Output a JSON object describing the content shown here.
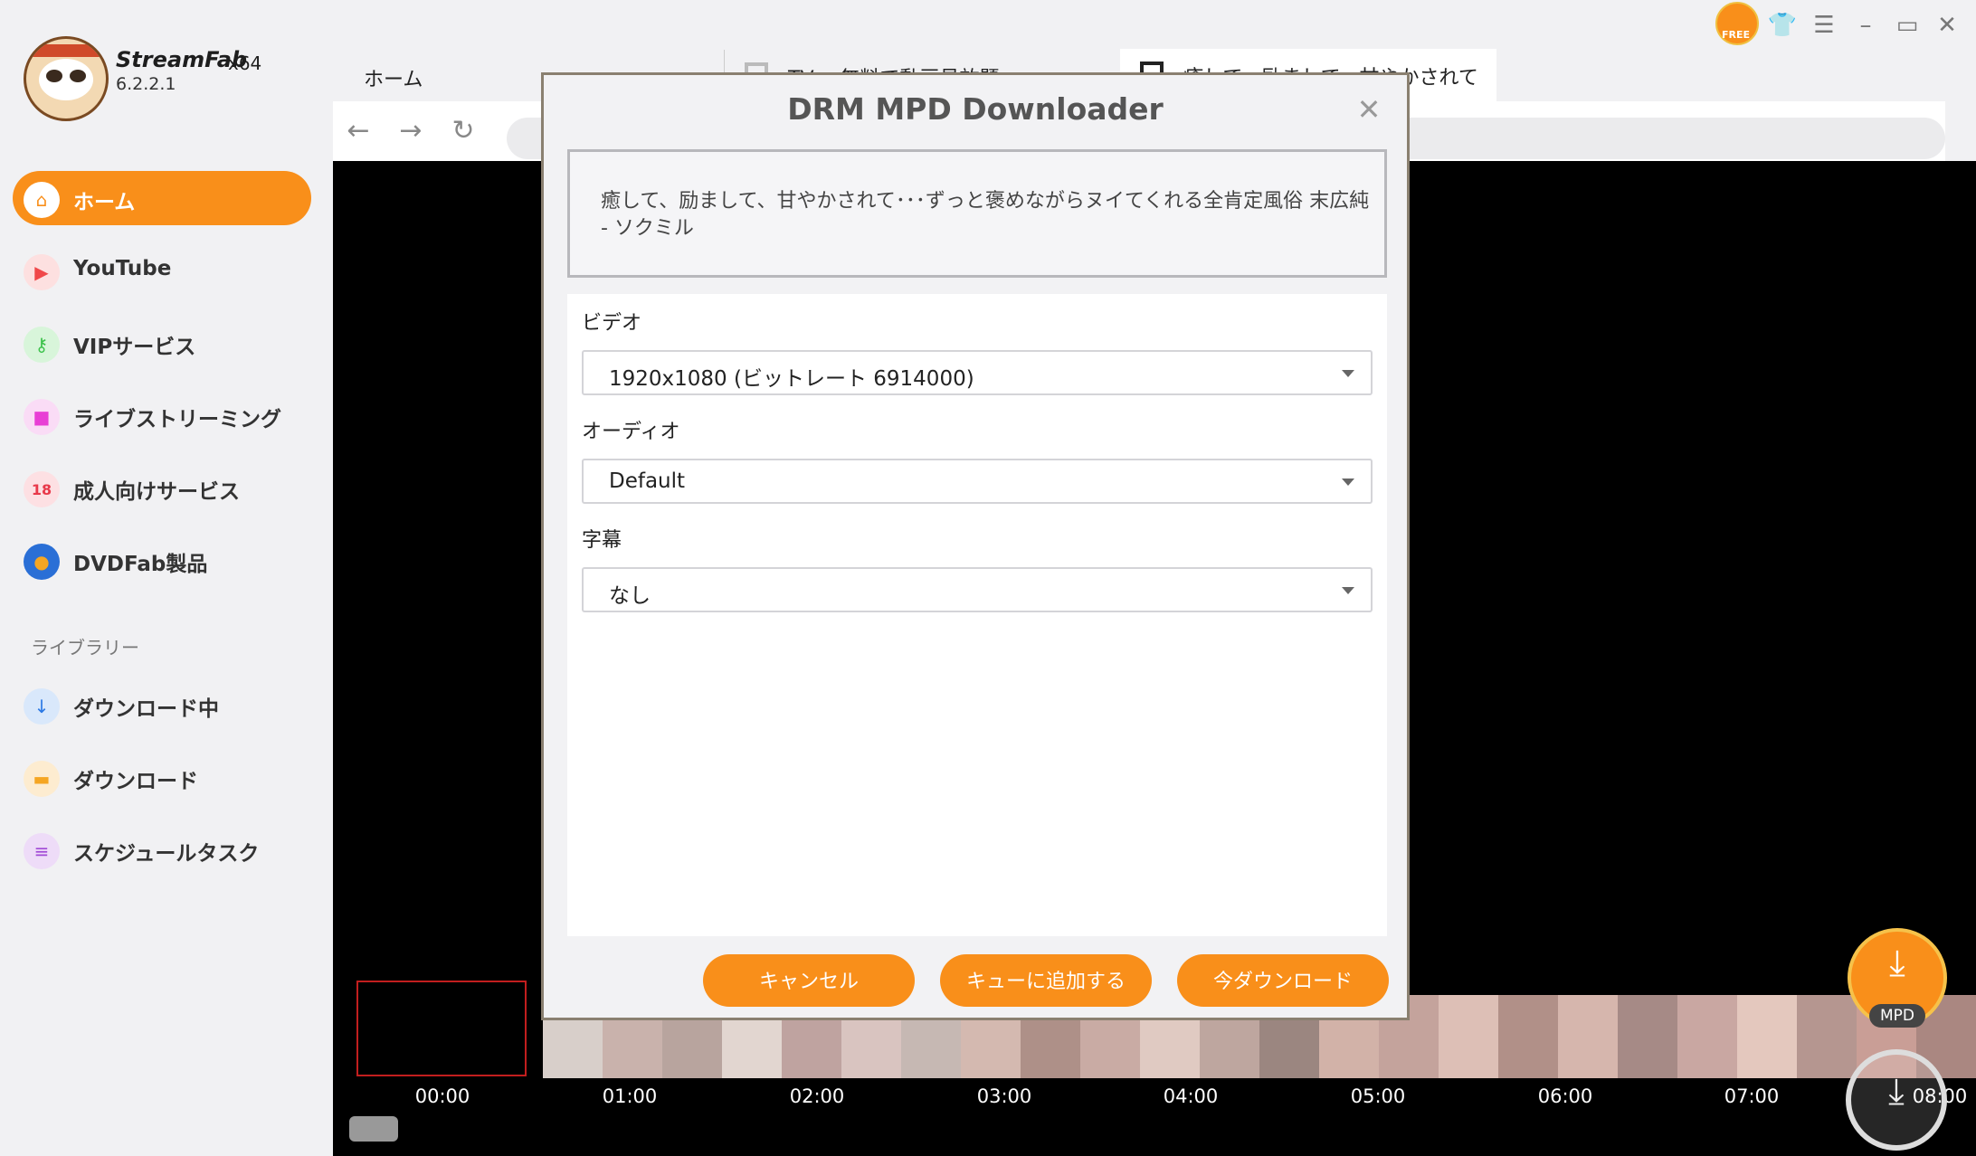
{
  "app": {
    "name": "StreamFab",
    "arch": "x64",
    "version": "6.2.2.1"
  },
  "sidebar": {
    "items": [
      {
        "label": "ホーム",
        "icon": "home-icon",
        "color": "#f98f1a"
      },
      {
        "label": "YouTube",
        "icon": "youtube-icon",
        "color": "#f0484a"
      },
      {
        "label": "VIPサービス",
        "icon": "key-icon",
        "color": "#3cc24b"
      },
      {
        "label": "ライブストリーミング",
        "icon": "camera-icon",
        "color": "#e83fd5"
      },
      {
        "label": "成人向けサービス",
        "icon": "adult-icon",
        "color": "#e8394a"
      },
      {
        "label": "DVDFab製品",
        "icon": "dvdfab-icon",
        "color": "#2a6fd6"
      }
    ],
    "library_label": "ライブラリー",
    "library": [
      {
        "label": "ダウンロード中",
        "icon": "download-arrow-icon",
        "color": "#2a78e4"
      },
      {
        "label": "ダウンロード",
        "icon": "folder-icon",
        "color": "#f5a623"
      },
      {
        "label": "スケジュールタスク",
        "icon": "schedule-icon",
        "color": "#a14ad6"
      }
    ]
  },
  "tabs": {
    "home": "ホーム",
    "tab2": "TV… 無料で動画見放題",
    "tab3": "癒して、励まして、甘やかされて"
  },
  "dialog": {
    "title": "DRM MPD Downloader",
    "video_title": "癒して、励まして、甘やかされて･･･ずっと褒めながらヌイてくれる全肯定風俗 末広純 - ソクミル",
    "video_label": "ビデオ",
    "video_value": "1920x1080 (ビットレート 6914000)",
    "audio_label": "オーディオ",
    "audio_value": "Default",
    "subtitle_label": "字幕",
    "subtitle_value": "なし",
    "cancel_label": "キャンセル",
    "queue_label": "キューに追加する",
    "download_label": "今ダウンロード"
  },
  "timeline": {
    "times": [
      "00:00",
      "01:00",
      "02:00",
      "03:00",
      "04:00",
      "05:00",
      "06:00",
      "07:00",
      "08:00"
    ]
  },
  "floating": {
    "mpd_label": "MPD"
  },
  "badges": {
    "free": "FREE"
  },
  "colors": {
    "accent": "#f98f1a",
    "sidebar_bg": "#f1f1f3"
  }
}
